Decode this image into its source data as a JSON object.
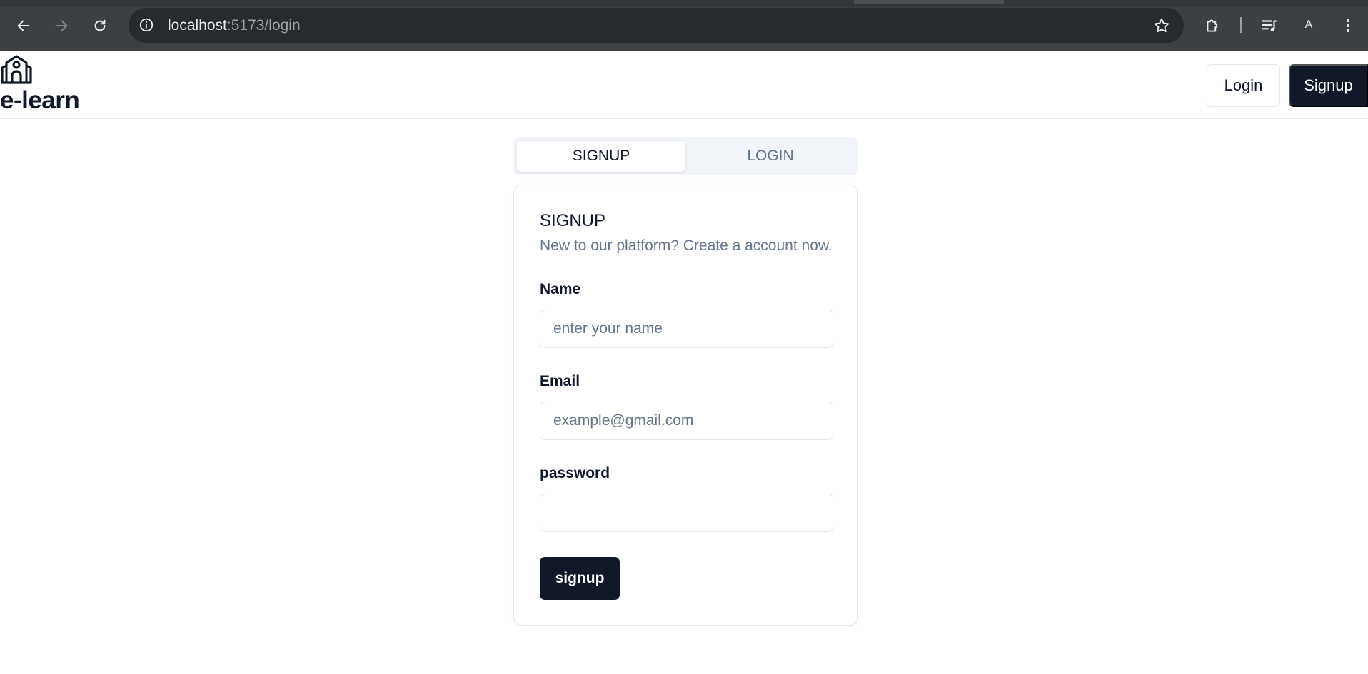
{
  "browser": {
    "url_host": "localhost",
    "url_rest": ":5173/login",
    "profile_initial": "A"
  },
  "header": {
    "brand": "e-learn",
    "login_label": "Login",
    "signup_label": "Signup"
  },
  "tabs": [
    {
      "label": "SIGNUP",
      "active": true
    },
    {
      "label": "LOGIN",
      "active": false
    }
  ],
  "card": {
    "title": "SIGNUP",
    "description": "New to our platform? Create a account now.",
    "fields": {
      "name": {
        "label": "Name",
        "placeholder": "enter your name",
        "value": ""
      },
      "email": {
        "label": "Email",
        "placeholder": "example@gmail.com",
        "value": ""
      },
      "password": {
        "label": "password",
        "placeholder": "",
        "value": ""
      }
    },
    "submit_label": "signup"
  },
  "colors": {
    "primary": "#111827",
    "muted_text": "#64748b",
    "border": "#e2e8f0",
    "tab_bg": "#f1f5f9"
  }
}
